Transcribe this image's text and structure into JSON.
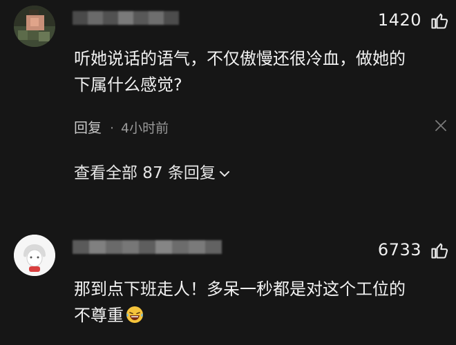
{
  "comments": [
    {
      "like_count": "1420",
      "text_line1": "听她说话的语气，不仅傲慢还很冷血，做她的",
      "text_line2": "下属什么感觉?",
      "reply_label": "回复",
      "time_label": "4小时前",
      "view_replies_label": "查看全部 87 条回复"
    },
    {
      "like_count": "6733",
      "text_line1": "那到点下班走人！多呆一秒都是对这个工位的",
      "text_line2": "不尊重"
    }
  ]
}
